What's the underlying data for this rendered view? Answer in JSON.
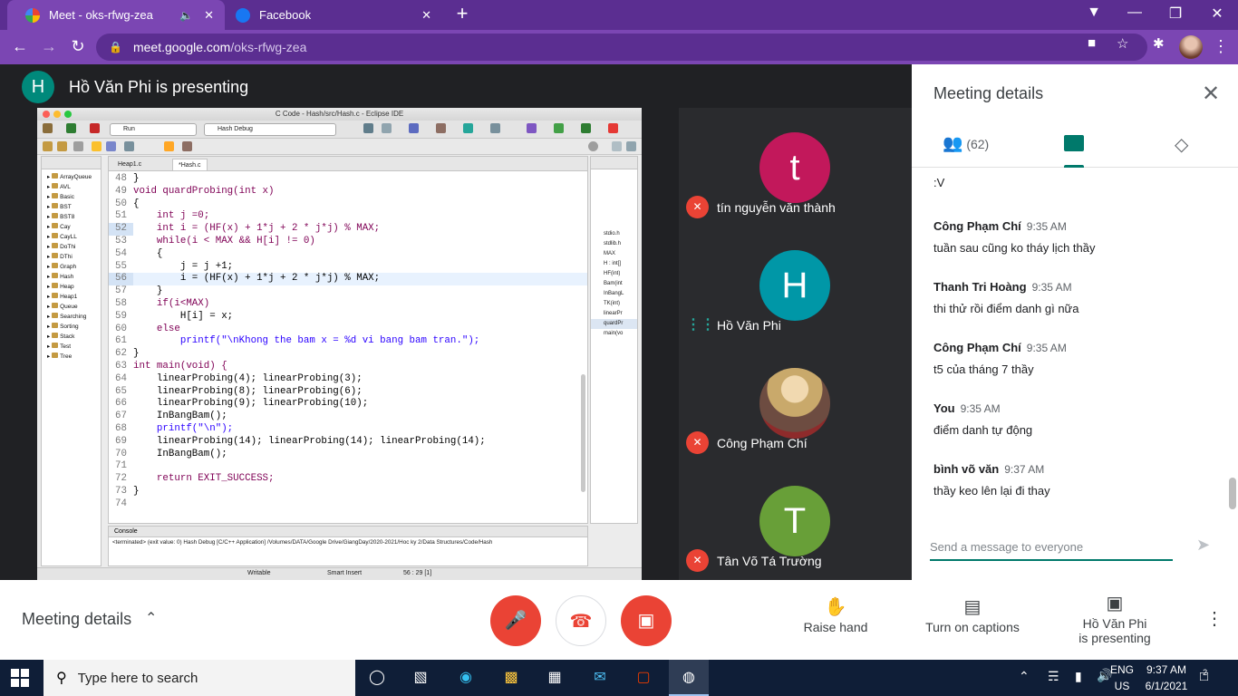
{
  "browser": {
    "tabs": [
      {
        "title": "Meet - oks-rfwg-zea",
        "active": true
      },
      {
        "title": "Facebook",
        "active": false
      }
    ],
    "url_host": "meet.google.com",
    "url_path": "/oks-rfwg-zea"
  },
  "meeting": {
    "presenter_initial": "H",
    "presenting_text": "Hồ Văn Phi is presenting"
  },
  "eclipse": {
    "window_title": "C Code - Hash/src/Hash.c - Eclipse IDE",
    "run_combo": "Run",
    "config_combo": "Hash Debug",
    "editor_tabs": [
      "Heap1.c",
      "*Hash.c"
    ],
    "project_items": [
      "ArrayQueue",
      "AVL",
      "Basic",
      "BST",
      "BST8",
      "Cay",
      "CayLL",
      "DoThi",
      "DThi",
      "Graph",
      "Hash",
      "Heap",
      "Heap1",
      "Queue",
      "Searching",
      "Sorting",
      "Stack",
      "Test",
      "Tree"
    ],
    "code_lines": [
      {
        "no": "48",
        "text": "}"
      },
      {
        "no": "49",
        "text": "void quardProbing(int x)"
      },
      {
        "no": "50",
        "text": "{"
      },
      {
        "no": "51",
        "text": "    int j =0;"
      },
      {
        "no": "52",
        "text": "    int i = (HF(x) + 1*j + 2 * j*j) % MAX;"
      },
      {
        "no": "53",
        "text": "    while(i < MAX && H[i] != 0)"
      },
      {
        "no": "54",
        "text": "    {"
      },
      {
        "no": "55",
        "text": "        j = j +1;"
      },
      {
        "no": "56",
        "text": "        i = (HF(x) + 1*j + 2 * j*j) % MAX;"
      },
      {
        "no": "57",
        "text": "    }"
      },
      {
        "no": "58",
        "text": "    if(i<MAX)"
      },
      {
        "no": "59",
        "text": "        H[i] = x;"
      },
      {
        "no": "60",
        "text": "    else"
      },
      {
        "no": "61",
        "text": "        printf(\"\\nKhong the bam x = %d vi bang bam tran.\");"
      },
      {
        "no": "62",
        "text": "}"
      },
      {
        "no": "63",
        "text": "int main(void) {"
      },
      {
        "no": "64",
        "text": "    linearProbing(4); linearProbing(3);"
      },
      {
        "no": "65",
        "text": "    linearProbing(8); linearProbing(6);"
      },
      {
        "no": "66",
        "text": "    linearProbing(9); linearProbing(10);"
      },
      {
        "no": "67",
        "text": "    InBangBam();"
      },
      {
        "no": "68",
        "text": "    printf(\"\\n\");"
      },
      {
        "no": "69",
        "text": "    linearProbing(14); linearProbing(14); linearProbing(14);"
      },
      {
        "no": "70",
        "text": "    InBangBam();"
      },
      {
        "no": "71",
        "text": ""
      },
      {
        "no": "72",
        "text": "    return EXIT_SUCCESS;"
      },
      {
        "no": "73",
        "text": "}"
      },
      {
        "no": "74",
        "text": ""
      }
    ],
    "outline_items": [
      "stdio.h",
      "stdlib.h",
      "MAX",
      "H : int[]",
      "HF(int)",
      "Bam(int",
      "InBangL",
      "TK(int)",
      "linearPr",
      "quardPr",
      "main(vo"
    ],
    "console_title": "Console",
    "console_text": "<terminated> (exit value: 0) Hash Debug [C/C++ Application] /Volumes/DATA/Google Drive/GiangDay/2020-2021/Hoc ky 2/Data Structures/Code/Hash",
    "status_writable": "Writable",
    "status_insert": "Smart Insert",
    "status_pos": "56 : 29 [1]"
  },
  "participants": [
    {
      "initial": "t",
      "name": "tín nguyễn văn thành",
      "color": "#c2185b",
      "muted": true
    },
    {
      "initial": "H",
      "name": "Hồ Văn Phi",
      "color": "#0097a7",
      "muted": false
    },
    {
      "initial": "",
      "name": "Công Phạm Chí",
      "color": "#8d6e63",
      "muted": true
    },
    {
      "initial": "T",
      "name": "Tân Võ Tá Trường",
      "color": "#689f38",
      "muted": true
    }
  ],
  "panel": {
    "title": "Meeting details",
    "people_count": "(62)",
    "messages": [
      {
        "sender": "",
        "time": "",
        "text": ":V"
      },
      {
        "sender": "Công Phạm Chí",
        "time": "9:35 AM",
        "text": "tuần sau cũng ko tháy lịch thầy"
      },
      {
        "sender": "Thanh Tri Hoàng",
        "time": "9:35 AM",
        "text": "thi thử rồi điểm danh gì nữa"
      },
      {
        "sender": "Công Phạm Chí",
        "time": "9:35 AM",
        "text": "t5 của tháng 7 thầy"
      },
      {
        "sender": "You",
        "time": "9:35 AM",
        "text": "điểm danh tự động"
      },
      {
        "sender": "bình võ văn",
        "time": "9:37 AM",
        "text": "thầy keo lên lại đi thay"
      }
    ],
    "compose_placeholder": "Send a message to everyone"
  },
  "controls": {
    "meeting_details": "Meeting details",
    "raise_hand": "Raise hand",
    "captions": "Turn on captions",
    "presenting_line1": "Hồ Văn Phi",
    "presenting_line2": "is presenting"
  },
  "taskbar": {
    "search_placeholder": "Type here to search",
    "lang_line1": "ENG",
    "lang_line2": "US",
    "time": "9:37 AM",
    "date": "6/1/2021",
    "notif_count": "2"
  }
}
